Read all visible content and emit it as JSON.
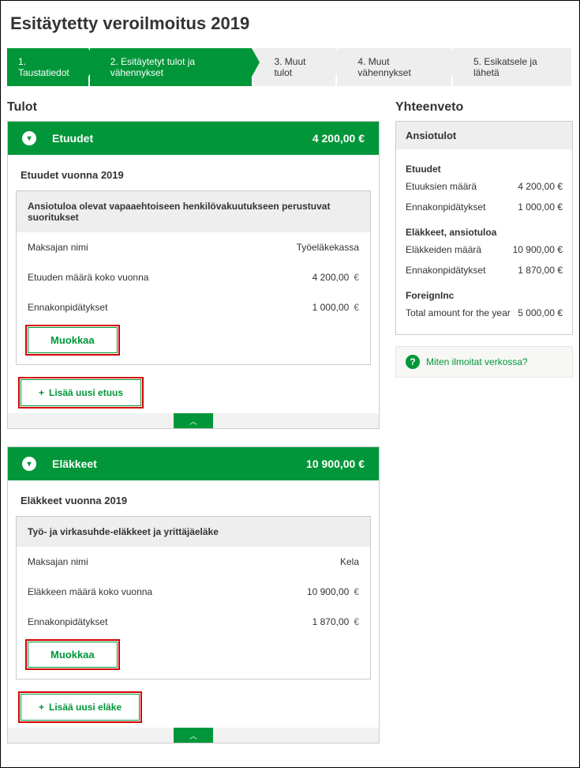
{
  "pageTitle": "Esitäytetty veroilmoitus 2019",
  "steps": [
    {
      "label": "1. Taustatiedot",
      "active": true
    },
    {
      "label": "2. Esitäytetyt tulot ja vähennykset",
      "active": true
    },
    {
      "label": "3. Muut tulot",
      "active": false
    },
    {
      "label": "4. Muut vähennykset",
      "active": false
    },
    {
      "label": "5. Esikatsele ja lähetä",
      "active": false
    }
  ],
  "mainHeading": "Tulot",
  "sections": [
    {
      "key": "etuudet",
      "title": "Etuudet",
      "amount": "4 200,00 €",
      "subheading": "Etuudet vuonna 2019",
      "cardTitle": "Ansiotuloa olevat vapaaehtoiseen henkilövakuutukseen perustuvat suoritukset",
      "rows": [
        {
          "label": "Maksajan nimi",
          "value": "Työeläkekassa",
          "currency": ""
        },
        {
          "label": "Etuuden määrä koko vuonna",
          "value": "4 200,00",
          "currency": "€"
        },
        {
          "label": "Ennakonpidätykset",
          "value": "1 000,00",
          "currency": "€"
        }
      ],
      "editLabel": "Muokkaa",
      "addLabel": "Lisää uusi etuus"
    },
    {
      "key": "elakkeet",
      "title": "Eläkkeet",
      "amount": "10 900,00 €",
      "subheading": "Eläkkeet vuonna 2019",
      "cardTitle": "Työ- ja virkasuhde-eläkkeet ja yrittäjäeläke",
      "rows": [
        {
          "label": "Maksajan nimi",
          "value": "Kela",
          "currency": ""
        },
        {
          "label": "Eläkkeen määrä koko vuonna",
          "value": "10 900,00",
          "currency": "€"
        },
        {
          "label": "Ennakonpidätykset",
          "value": "1 870,00",
          "currency": "€"
        }
      ],
      "editLabel": "Muokkaa",
      "addLabel": "Lisää uusi eläke"
    }
  ],
  "sideHeading": "Yhteenveto",
  "summary": {
    "title": "Ansiotulot",
    "groups": [
      {
        "heading": "Etuudet",
        "lines": [
          {
            "label": "Etuuksien määrä",
            "value": "4 200,00",
            "cur": "€"
          },
          {
            "label": "Ennakonpidätykset",
            "value": "1 000,00",
            "cur": "€"
          }
        ]
      },
      {
        "heading": "Eläkkeet, ansiotuloa",
        "lines": [
          {
            "label": "Eläkkeiden määrä",
            "value": "10 900,00",
            "cur": "€"
          },
          {
            "label": "Ennakonpidätykset",
            "value": "1 870,00",
            "cur": "€"
          }
        ]
      },
      {
        "heading": "ForeignInc",
        "lines": [
          {
            "label": "Total amount for the year",
            "value": "5 000,00",
            "cur": "€"
          }
        ]
      }
    ]
  },
  "helpText": "Miten ilmoitat verkossa?",
  "collapseGlyph": "︿",
  "plus": "+"
}
